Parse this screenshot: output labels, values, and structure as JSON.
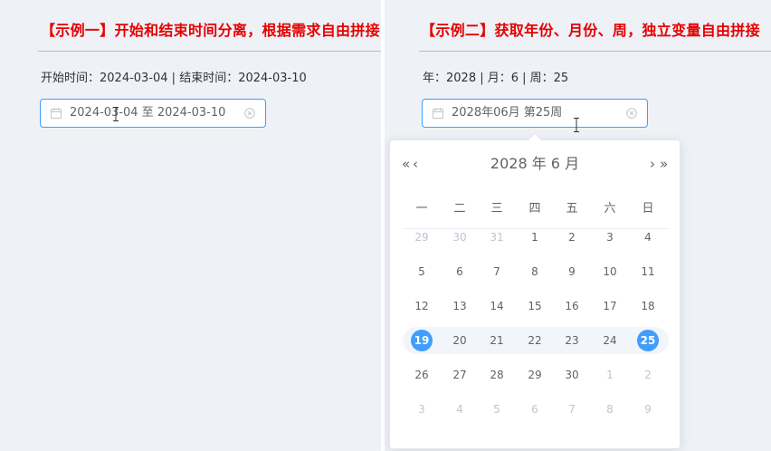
{
  "example1": {
    "title": "【示例一】开始和结束时间分离，根据需求自由拼接",
    "info": "开始时间：2024-03-04 | 结束时间：2024-03-10",
    "picker_value": "2024-03-04 至 2024-03-10"
  },
  "example2": {
    "title": "【示例二】获取年份、月份、周，独立变量自由拼接",
    "info": "年：2028 | 月：6 | 周：25",
    "picker_value": "2028年06月 第25周"
  },
  "calendar": {
    "header": "2028 年  6 月",
    "nav": {
      "prev_year": "«",
      "prev_month": "‹",
      "next_month": "›",
      "next_year": "»"
    },
    "weekdays": [
      "一",
      "二",
      "三",
      "四",
      "五",
      "六",
      "日"
    ],
    "weeks": [
      [
        "29",
        "30",
        "31",
        "1",
        "2",
        "3",
        "4"
      ],
      [
        "5",
        "6",
        "7",
        "8",
        "9",
        "10",
        "11"
      ],
      [
        "12",
        "13",
        "14",
        "15",
        "16",
        "17",
        "18"
      ],
      [
        "19",
        "20",
        "21",
        "22",
        "23",
        "24",
        "25"
      ],
      [
        "26",
        "27",
        "28",
        "29",
        "30",
        "1",
        "2"
      ],
      [
        "3",
        "4",
        "5",
        "6",
        "7",
        "8",
        "9"
      ]
    ],
    "muted_days": [
      [
        0,
        0
      ],
      [
        0,
        1
      ],
      [
        0,
        2
      ],
      [
        4,
        5
      ],
      [
        4,
        6
      ],
      [
        5,
        0
      ],
      [
        5,
        1
      ],
      [
        5,
        2
      ],
      [
        5,
        3
      ],
      [
        5,
        4
      ],
      [
        5,
        5
      ],
      [
        5,
        6
      ]
    ],
    "selected_week": 3,
    "icons": {
      "calendar": "calendar-icon",
      "clear": "circle-close-icon"
    },
    "colors": {
      "accent": "#409eff",
      "title": "#e60000",
      "muted": "#c0c4cc"
    }
  }
}
